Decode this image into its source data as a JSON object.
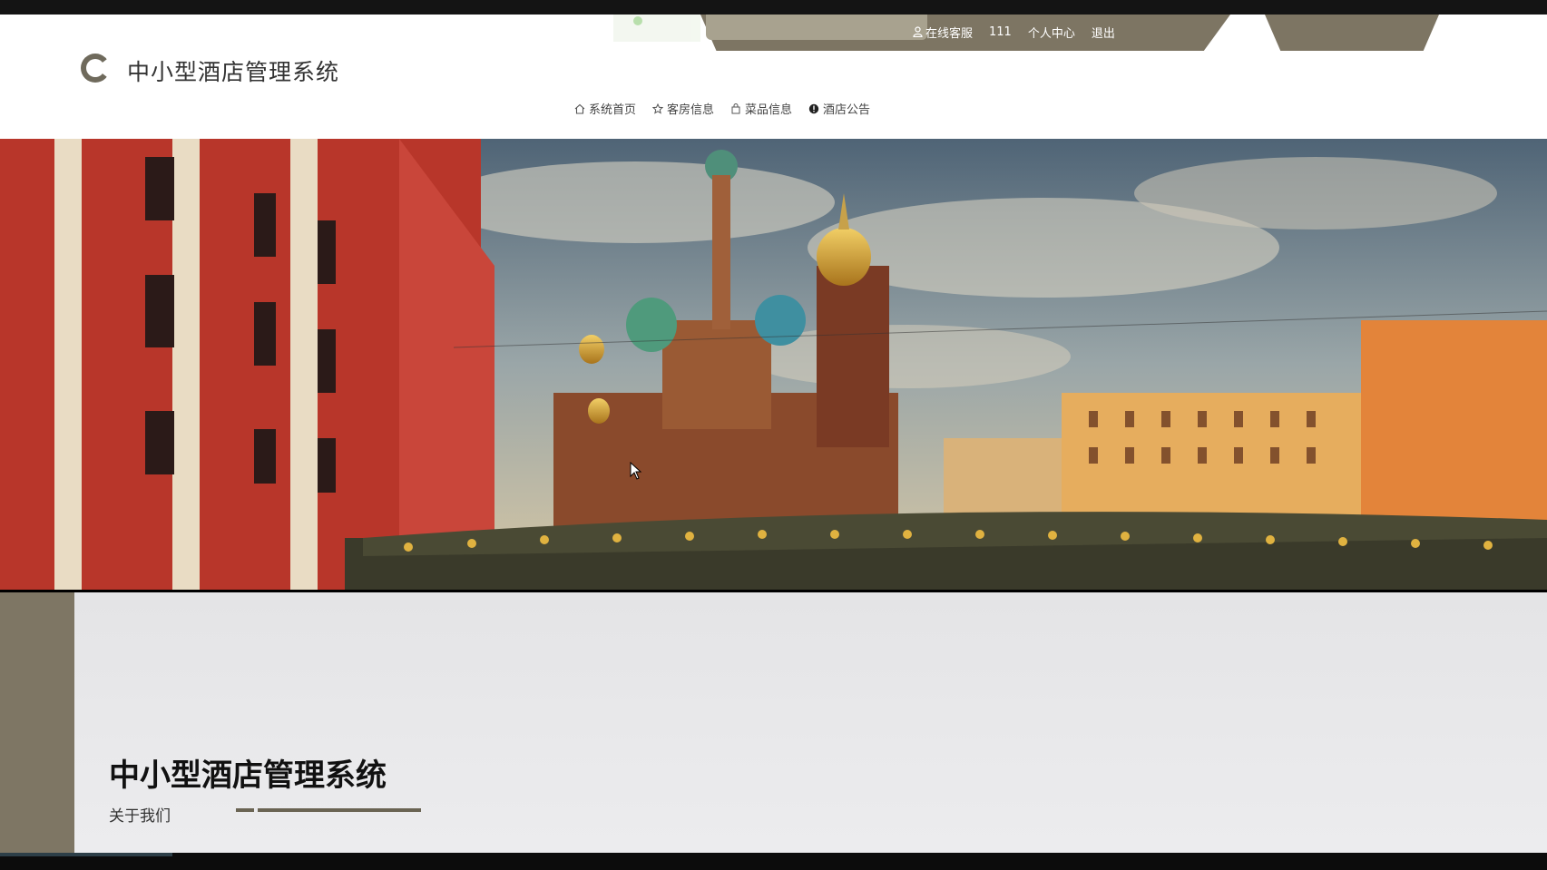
{
  "header": {
    "site_title": "中小型酒店管理系统",
    "logo_icon": "logo-icon"
  },
  "top_links": [
    {
      "label": "在线客服",
      "icon": "user-icon"
    },
    {
      "label": "111"
    },
    {
      "label": "个人中心"
    },
    {
      "label": "退出"
    }
  ],
  "nav": [
    {
      "label": "系统首页",
      "icon": "home-icon"
    },
    {
      "label": "客房信息",
      "icon": "star-icon"
    },
    {
      "label": "菜品信息",
      "icon": "bag-icon"
    },
    {
      "label": "酒店公告",
      "icon": "info-icon"
    }
  ],
  "about": {
    "title": "中小型酒店管理系统",
    "subtitle": "关于我们"
  },
  "colors": {
    "accent": "#7d7563",
    "accent_light": "#a8a28f",
    "about_bg": "#e8e8ea"
  }
}
